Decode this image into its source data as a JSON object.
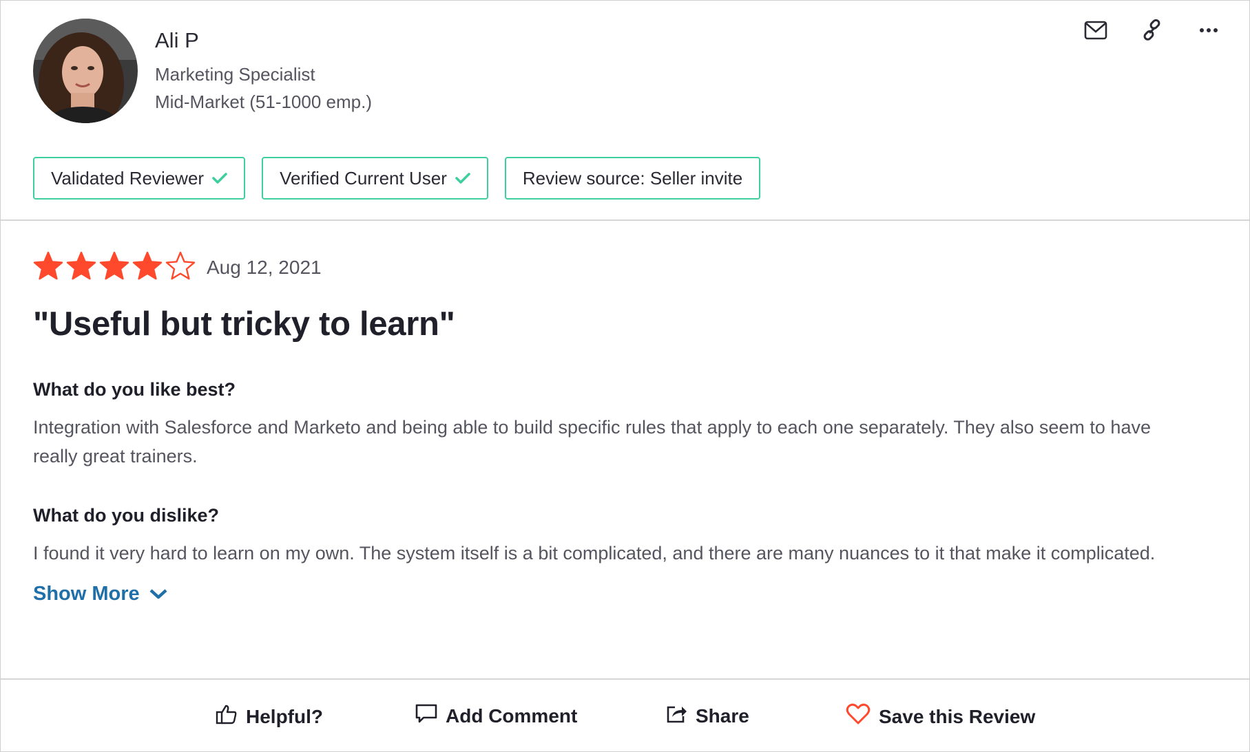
{
  "reviewer": {
    "name": "Ali P",
    "role": "Marketing Specialist",
    "segment": "Mid-Market (51-1000 emp.)"
  },
  "badges": [
    {
      "label": "Validated Reviewer",
      "checked": true
    },
    {
      "label": "Verified Current User",
      "checked": true
    },
    {
      "label": "Review source: Seller invite",
      "checked": false
    }
  ],
  "actions": {
    "icons": [
      "mail-icon",
      "link-icon",
      "more-options-icon"
    ]
  },
  "review": {
    "rating": 4,
    "rating_max": 5,
    "date": "Aug 12, 2021",
    "title": "\"Useful but tricky to learn\"",
    "q1": "What do you like best?",
    "a1": "Integration with Salesforce and Marketo and being able to build specific rules that apply to each one separately. They also seem to have really great trainers.",
    "q2": "What do you dislike?",
    "a2": "I found it very hard to learn on my own. The system itself is a bit complicated, and there are many nuances to it that make it complicated.",
    "show_more": "Show More"
  },
  "footer": {
    "helpful": "Helpful?",
    "add_comment": "Add Comment",
    "share": "Share",
    "save": "Save this Review"
  },
  "colors": {
    "star": "#ff492c",
    "badge_border": "#3fcf9c",
    "link": "#1f6fa8",
    "heart": "#ff492c"
  }
}
